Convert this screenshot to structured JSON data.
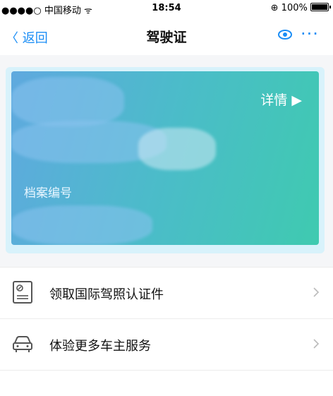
{
  "status": {
    "carrier": "●●●●○ 中国移动 ᯤ",
    "time": "18:54",
    "battery": "⊕ 100%"
  },
  "nav": {
    "back_label": "〈 返回",
    "title": "驾驶证",
    "more_label": "···"
  },
  "card": {
    "detail_label": "详情 ▶",
    "file_number_label": "档案编号"
  },
  "menu": [
    {
      "label": "领取国际驾照认证件",
      "icon": "license-document-icon"
    },
    {
      "label": "体验更多车主服务",
      "icon": "car-icon"
    }
  ],
  "colors": {
    "accent": "#1a8df5",
    "card_start": "#5fa9df",
    "card_end": "#3fcab0"
  }
}
